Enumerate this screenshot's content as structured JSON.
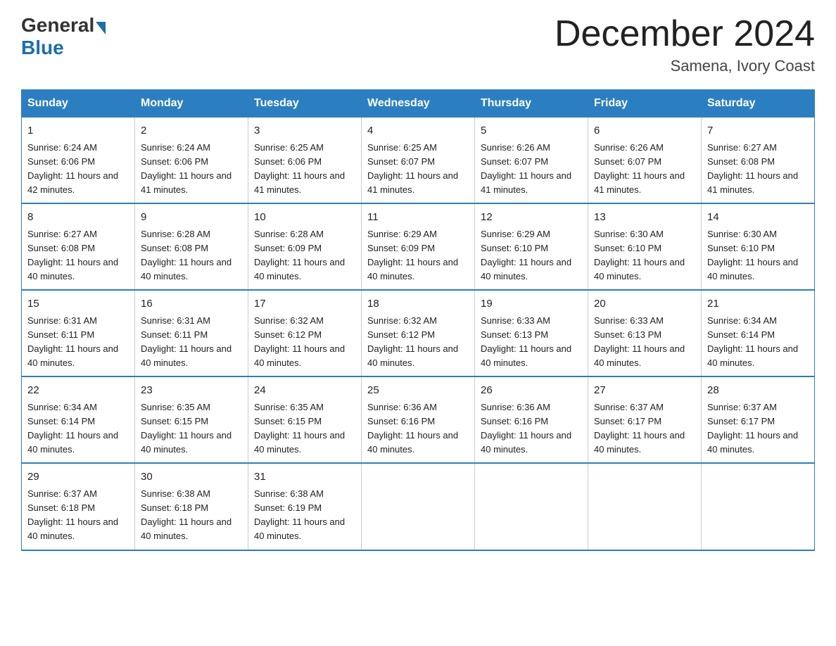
{
  "header": {
    "logo_general": "General",
    "logo_blue": "Blue",
    "title": "December 2024",
    "subtitle": "Samena, Ivory Coast"
  },
  "weekdays": [
    "Sunday",
    "Monday",
    "Tuesday",
    "Wednesday",
    "Thursday",
    "Friday",
    "Saturday"
  ],
  "weeks": [
    [
      {
        "day": "1",
        "sunrise": "6:24 AM",
        "sunset": "6:06 PM",
        "daylight": "11 hours and 42 minutes."
      },
      {
        "day": "2",
        "sunrise": "6:24 AM",
        "sunset": "6:06 PM",
        "daylight": "11 hours and 41 minutes."
      },
      {
        "day": "3",
        "sunrise": "6:25 AM",
        "sunset": "6:06 PM",
        "daylight": "11 hours and 41 minutes."
      },
      {
        "day": "4",
        "sunrise": "6:25 AM",
        "sunset": "6:07 PM",
        "daylight": "11 hours and 41 minutes."
      },
      {
        "day": "5",
        "sunrise": "6:26 AM",
        "sunset": "6:07 PM",
        "daylight": "11 hours and 41 minutes."
      },
      {
        "day": "6",
        "sunrise": "6:26 AM",
        "sunset": "6:07 PM",
        "daylight": "11 hours and 41 minutes."
      },
      {
        "day": "7",
        "sunrise": "6:27 AM",
        "sunset": "6:08 PM",
        "daylight": "11 hours and 41 minutes."
      }
    ],
    [
      {
        "day": "8",
        "sunrise": "6:27 AM",
        "sunset": "6:08 PM",
        "daylight": "11 hours and 40 minutes."
      },
      {
        "day": "9",
        "sunrise": "6:28 AM",
        "sunset": "6:08 PM",
        "daylight": "11 hours and 40 minutes."
      },
      {
        "day": "10",
        "sunrise": "6:28 AM",
        "sunset": "6:09 PM",
        "daylight": "11 hours and 40 minutes."
      },
      {
        "day": "11",
        "sunrise": "6:29 AM",
        "sunset": "6:09 PM",
        "daylight": "11 hours and 40 minutes."
      },
      {
        "day": "12",
        "sunrise": "6:29 AM",
        "sunset": "6:10 PM",
        "daylight": "11 hours and 40 minutes."
      },
      {
        "day": "13",
        "sunrise": "6:30 AM",
        "sunset": "6:10 PM",
        "daylight": "11 hours and 40 minutes."
      },
      {
        "day": "14",
        "sunrise": "6:30 AM",
        "sunset": "6:10 PM",
        "daylight": "11 hours and 40 minutes."
      }
    ],
    [
      {
        "day": "15",
        "sunrise": "6:31 AM",
        "sunset": "6:11 PM",
        "daylight": "11 hours and 40 minutes."
      },
      {
        "day": "16",
        "sunrise": "6:31 AM",
        "sunset": "6:11 PM",
        "daylight": "11 hours and 40 minutes."
      },
      {
        "day": "17",
        "sunrise": "6:32 AM",
        "sunset": "6:12 PM",
        "daylight": "11 hours and 40 minutes."
      },
      {
        "day": "18",
        "sunrise": "6:32 AM",
        "sunset": "6:12 PM",
        "daylight": "11 hours and 40 minutes."
      },
      {
        "day": "19",
        "sunrise": "6:33 AM",
        "sunset": "6:13 PM",
        "daylight": "11 hours and 40 minutes."
      },
      {
        "day": "20",
        "sunrise": "6:33 AM",
        "sunset": "6:13 PM",
        "daylight": "11 hours and 40 minutes."
      },
      {
        "day": "21",
        "sunrise": "6:34 AM",
        "sunset": "6:14 PM",
        "daylight": "11 hours and 40 minutes."
      }
    ],
    [
      {
        "day": "22",
        "sunrise": "6:34 AM",
        "sunset": "6:14 PM",
        "daylight": "11 hours and 40 minutes."
      },
      {
        "day": "23",
        "sunrise": "6:35 AM",
        "sunset": "6:15 PM",
        "daylight": "11 hours and 40 minutes."
      },
      {
        "day": "24",
        "sunrise": "6:35 AM",
        "sunset": "6:15 PM",
        "daylight": "11 hours and 40 minutes."
      },
      {
        "day": "25",
        "sunrise": "6:36 AM",
        "sunset": "6:16 PM",
        "daylight": "11 hours and 40 minutes."
      },
      {
        "day": "26",
        "sunrise": "6:36 AM",
        "sunset": "6:16 PM",
        "daylight": "11 hours and 40 minutes."
      },
      {
        "day": "27",
        "sunrise": "6:37 AM",
        "sunset": "6:17 PM",
        "daylight": "11 hours and 40 minutes."
      },
      {
        "day": "28",
        "sunrise": "6:37 AM",
        "sunset": "6:17 PM",
        "daylight": "11 hours and 40 minutes."
      }
    ],
    [
      {
        "day": "29",
        "sunrise": "6:37 AM",
        "sunset": "6:18 PM",
        "daylight": "11 hours and 40 minutes."
      },
      {
        "day": "30",
        "sunrise": "6:38 AM",
        "sunset": "6:18 PM",
        "daylight": "11 hours and 40 minutes."
      },
      {
        "day": "31",
        "sunrise": "6:38 AM",
        "sunset": "6:19 PM",
        "daylight": "11 hours and 40 minutes."
      },
      null,
      null,
      null,
      null
    ]
  ]
}
